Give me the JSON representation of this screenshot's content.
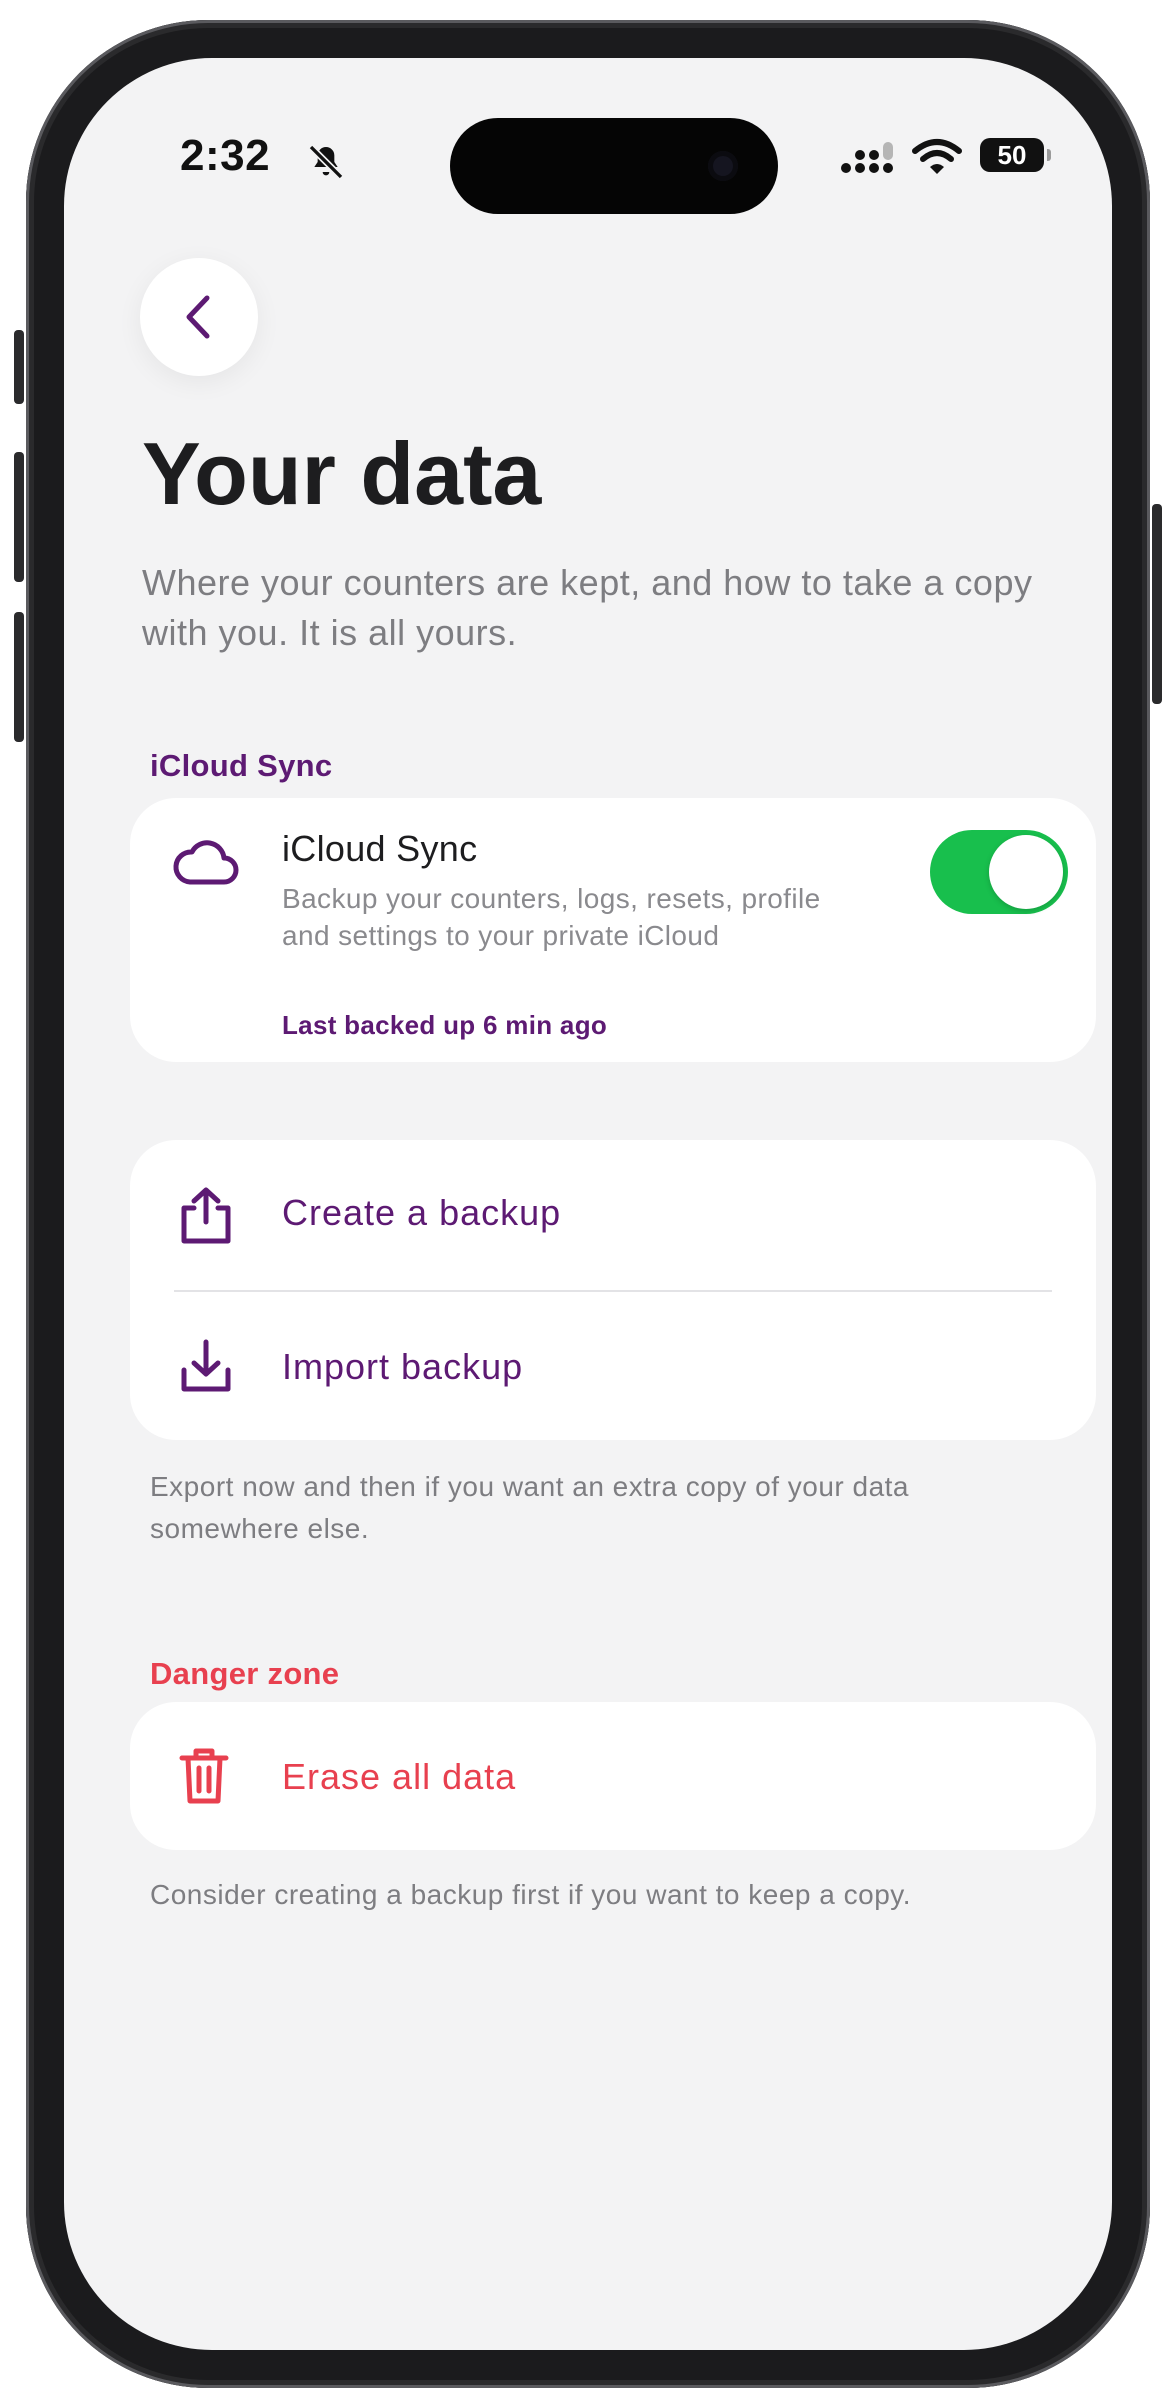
{
  "status_bar": {
    "time": "2:32",
    "battery_level": "50",
    "icons": [
      "bell-slash-icon",
      "signal-icon",
      "wifi-icon",
      "battery-icon"
    ]
  },
  "header": {
    "back_icon": "chevron-left-icon",
    "title": "Your data",
    "subtitle": "Where your counters are kept, and how to take a copy with you. It is all yours."
  },
  "icloud_section": {
    "header": "iCloud Sync",
    "item": {
      "icon": "cloud-icon",
      "title": "iCloud Sync",
      "description": "Backup your counters, logs, resets, profile and settings to your private iCloud",
      "status": "Last backed up 6 min ago",
      "enabled": true
    }
  },
  "backup_section": {
    "items": [
      {
        "icon": "share-upload-icon",
        "label": "Create a backup"
      },
      {
        "icon": "download-icon",
        "label": "Import backup"
      }
    ],
    "footnote": "Export now and then if you want an extra copy of your data somewhere else."
  },
  "danger_section": {
    "header": "Danger zone",
    "item": {
      "icon": "trash-icon",
      "label": "Erase all data"
    },
    "footnote": "Consider creating a backup first if you want to keep a copy."
  },
  "colors": {
    "accent_purple": "#5d1a73",
    "danger_red": "#e8404f",
    "toggle_green": "#18bf4d",
    "background": "#f3f3f4",
    "card": "#ffffff"
  }
}
